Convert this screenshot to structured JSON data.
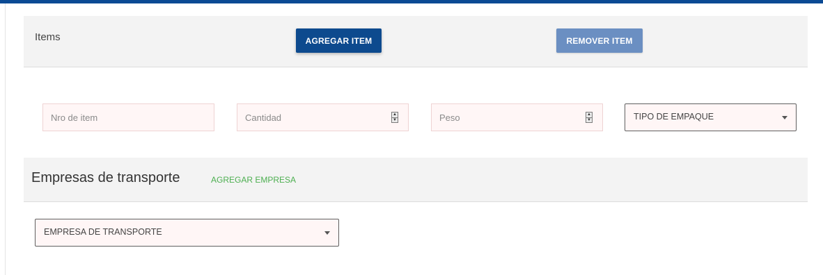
{
  "items_section": {
    "title": "Items",
    "add_button": "AGREGAR ITEM",
    "remove_button": "REMOVER ITEM"
  },
  "item_form": {
    "item_number_placeholder": "Nro de item",
    "quantity_placeholder": "Cantidad",
    "weight_placeholder": "Peso",
    "package_type_select": "TIPO DE EMPAQUE"
  },
  "companies_section": {
    "title": "Empresas de transporte",
    "add_link": "AGREGAR EMPRESA",
    "company_select": "EMPRESA DE TRANSPORTE"
  },
  "colors": {
    "primary": "#0d4a8e",
    "primary_light": "#6b8fc2",
    "link_green": "#4caf50",
    "field_bg": "#fff6f6"
  }
}
